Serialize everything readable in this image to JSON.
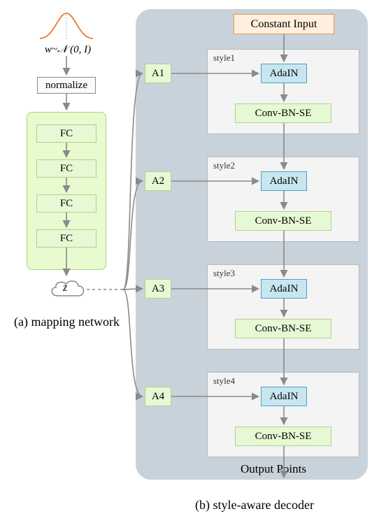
{
  "mapping": {
    "latent": "w~𝒩 (0, I)",
    "normalize": "normalize",
    "fc": "FC",
    "z": "z",
    "caption": "(a) mapping network"
  },
  "decoder": {
    "constant_input": "Constant Input",
    "adain": "AdaIN",
    "conv": "Conv-BN-SE",
    "a1": "A1",
    "a2": "A2",
    "a3": "A3",
    "a4": "A4",
    "style1": "style1",
    "style2": "style2",
    "style3": "style3",
    "style4": "style4",
    "output": "Output Points",
    "caption": "(b) style-aware decoder"
  },
  "chart_data": {
    "type": "diagram",
    "title": "Mapping network and style-aware decoder",
    "mapping_network": {
      "input": "w ~ N(0, I)",
      "steps": [
        "normalize",
        "FC",
        "FC",
        "FC",
        "FC"
      ],
      "output": "z"
    },
    "style_aware_decoder": {
      "input": "Constant Input",
      "blocks": [
        {
          "name": "style1",
          "affine": "A1",
          "ops": [
            "AdaIN",
            "Conv-BN-SE"
          ]
        },
        {
          "name": "style2",
          "affine": "A2",
          "ops": [
            "AdaIN",
            "Conv-BN-SE"
          ]
        },
        {
          "name": "style3",
          "affine": "A3",
          "ops": [
            "AdaIN",
            "Conv-BN-SE"
          ]
        },
        {
          "name": "style4",
          "affine": "A4",
          "ops": [
            "AdaIN",
            "Conv-BN-SE"
          ]
        }
      ],
      "style_source": "z (dashed connection to all A1..A4)",
      "output": "Output Points"
    }
  }
}
